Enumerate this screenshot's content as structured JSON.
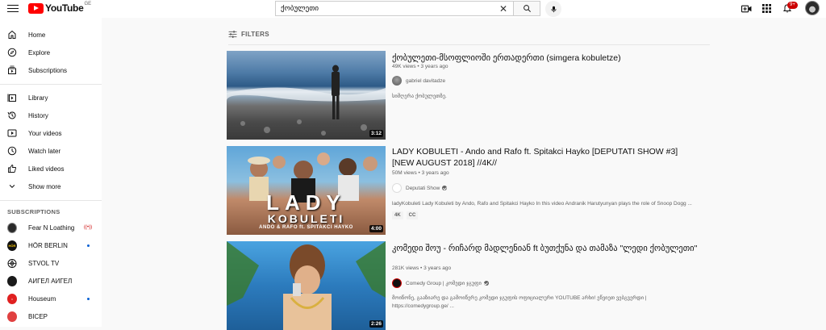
{
  "header": {
    "logo_text": "YouTube",
    "logo_country": "GE",
    "search_value": "ქობულეთი",
    "notification_count": "9+"
  },
  "sidebar": {
    "main_items": [
      {
        "label": "Home",
        "icon": "home-icon"
      },
      {
        "label": "Explore",
        "icon": "compass-icon"
      },
      {
        "label": "Subscriptions",
        "icon": "subscriptions-icon"
      }
    ],
    "library_items": [
      {
        "label": "Library",
        "icon": "library-icon"
      },
      {
        "label": "History",
        "icon": "history-icon"
      },
      {
        "label": "Your videos",
        "icon": "your-videos-icon"
      },
      {
        "label": "Watch later",
        "icon": "clock-icon"
      },
      {
        "label": "Liked videos",
        "icon": "thumb-up-icon"
      },
      {
        "label": "Show more",
        "icon": "chevron-down-icon"
      }
    ],
    "subscriptions_heading": "SUBSCRIPTIONS",
    "subscriptions": [
      {
        "label": "Fear N Loathing",
        "status": "live",
        "avatar_color": "#2a2a2a"
      },
      {
        "label": "HÖR BERLIN",
        "status": "new",
        "avatar_color": "#111111"
      },
      {
        "label": "STVOL TV",
        "status": "",
        "avatar_color": "#ffffff"
      },
      {
        "label": "АИГЕЛ АИГЕЛ",
        "status": "",
        "avatar_color": "#1a1a1a"
      },
      {
        "label": "Houseum",
        "status": "new",
        "avatar_color": "#e02020"
      },
      {
        "label": "BICEP",
        "status": "",
        "avatar_color": "#e04040"
      }
    ]
  },
  "filters_label": "FILTERS",
  "results": [
    {
      "title": "ქობულეთი-მსოფლიოში ერთადერთი (simgera kobuletze)",
      "views": "49K views",
      "age": "3 years ago",
      "channel": "gabriel davitadze",
      "verified": false,
      "description": "სიმღერა ქობულეთზე.",
      "duration": "3:12",
      "badges": []
    },
    {
      "title": "LADY KOBULETI - Ando and Rafo ft. Spitakci Hayko [DEPUTATI SHOW #3] [NEW AUGUST 2018] //4K//",
      "views": "50M views",
      "age": "3 years ago",
      "channel": "Deputati Show",
      "verified": true,
      "description": "ladyKobuleti Lady Kobuleti by Ando, Rafo and Spitakci Hayko In this video Andranik Harutyunyan plays the role of Snoop Dogg ...",
      "duration": "4:00",
      "badges": [
        "4K",
        "CC"
      ],
      "thumb_text_1": "LADY",
      "thumb_text_2": "KOBULETI",
      "thumb_text_3": "ANDO & RAFO ft. SPITAKCI HAYKO"
    },
    {
      "title": "კომედი შოუ - რიჩარდ მადლენიან ft ბუთქუნა და თამაზა \"ლედი ქობულეთი\"",
      "views": "281K views",
      "age": "3 years ago",
      "channel": "Comedy Group | კომედი ჯგუფი",
      "verified": true,
      "description": "მოიწონე, გააზიარე და გამოიწერე კომედი ჯგუფის ოფიციალური YOUTUBE არხი! ეწვიეთ ვებგვერდი | https://comedygroup.ge/ ...",
      "duration": "2:26",
      "badges": []
    }
  ]
}
